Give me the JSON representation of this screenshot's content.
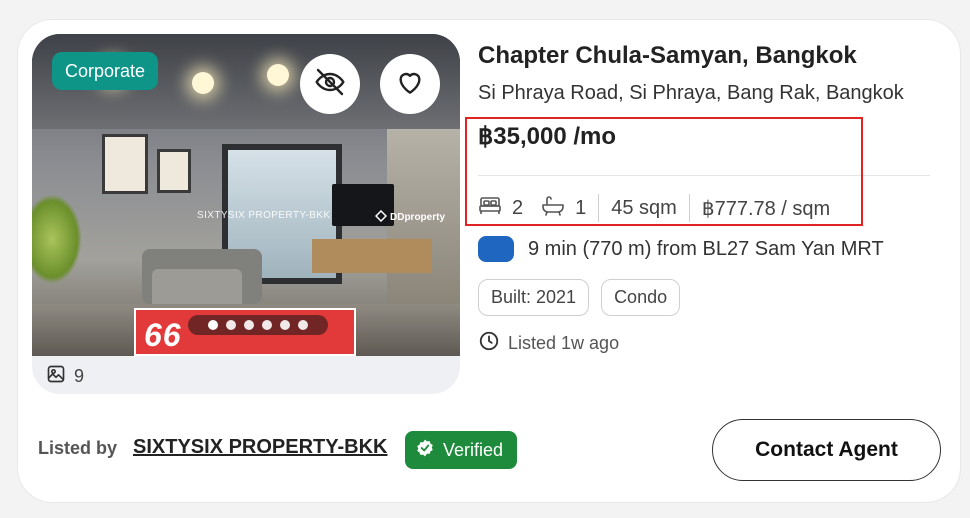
{
  "listing": {
    "badge": "Corporate",
    "photo_count": "9",
    "watermark_text": "SIXTYSIX PROPERTY-BKK",
    "watermark_logo": "DDproperty",
    "banner_text": "66 PROPERTY",
    "carousel": {
      "total_dots": 6,
      "active_index": 0
    },
    "title": "Chapter Chula-Samyan, Bangkok",
    "address": "Si Phraya Road, Si Phraya, Bang Rak, Bangkok",
    "price": "฿35,000 /mo",
    "specs": {
      "bedrooms": "2",
      "bathrooms": "1",
      "area": "45 sqm",
      "price_per_sqm": "฿777.78 / sqm"
    },
    "transit": {
      "text": "9 min (770 m) from BL27 Sam Yan MRT",
      "line_color": "#1f66c1"
    },
    "tags": [
      "Built: 2021",
      "Condo"
    ],
    "listed_time": "Listed 1w ago"
  },
  "footer": {
    "listed_by_label": "Listed by",
    "agent_name": "SIXTYSIX PROPERTY-BKK",
    "verified_label": "Verified",
    "contact_label": "Contact Agent"
  },
  "colors": {
    "accent_teal": "#0f9488",
    "verified_green": "#1e8a3c",
    "highlight_red": "#e02424"
  },
  "icons": {
    "hide": "eye-off-icon",
    "favorite": "heart-icon",
    "gallery": "image-icon",
    "bed": "bed-icon",
    "bath": "bathtub-icon",
    "clock": "clock-icon",
    "verified": "shield-check-icon"
  }
}
